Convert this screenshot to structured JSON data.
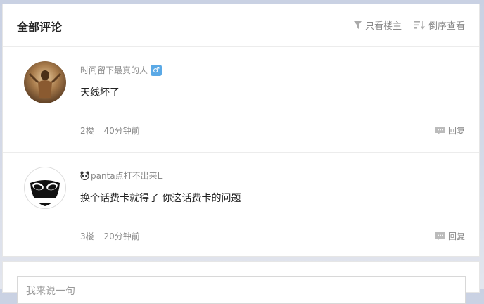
{
  "header": {
    "title": "全部评论",
    "filter_owner": "只看楼主",
    "filter_reverse": "倒序查看"
  },
  "comments": [
    {
      "username": "时间留下最真的人",
      "gender_symbol": "♂",
      "content": "天线坏了",
      "floor": "2楼",
      "time": "40分钟前",
      "reply": "回复"
    },
    {
      "username": "panta点打不出来L",
      "content": "换个话费卡就得了 你这话费卡的问题",
      "floor": "3楼",
      "time": "20分钟前",
      "reply": "回复"
    }
  ],
  "input": {
    "placeholder": "我来说一句"
  },
  "colors": {
    "gender_badge": "#5aa9e6",
    "meta_text": "#888888"
  }
}
